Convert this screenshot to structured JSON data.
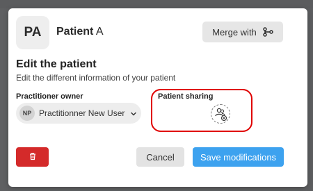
{
  "patient": {
    "initials": "PA",
    "first": "Patient",
    "last": "A"
  },
  "merge": {
    "label": "Merge with",
    "icon": "merge-branch-icon"
  },
  "edit": {
    "title": "Edit the patient",
    "subtitle": "Edit the different information of your patient"
  },
  "owner": {
    "label": "Practitioner owner",
    "initials": "NP",
    "name": "Practitionner New User"
  },
  "sharing": {
    "label": "Patient sharing",
    "icon": "add-users-icon"
  },
  "actions": {
    "delete_icon": "trash-icon",
    "cancel": "Cancel",
    "save": "Save modifications"
  },
  "colors": {
    "delete": "#d42a2a",
    "save": "#3da2ef",
    "highlight": "#e00000"
  }
}
